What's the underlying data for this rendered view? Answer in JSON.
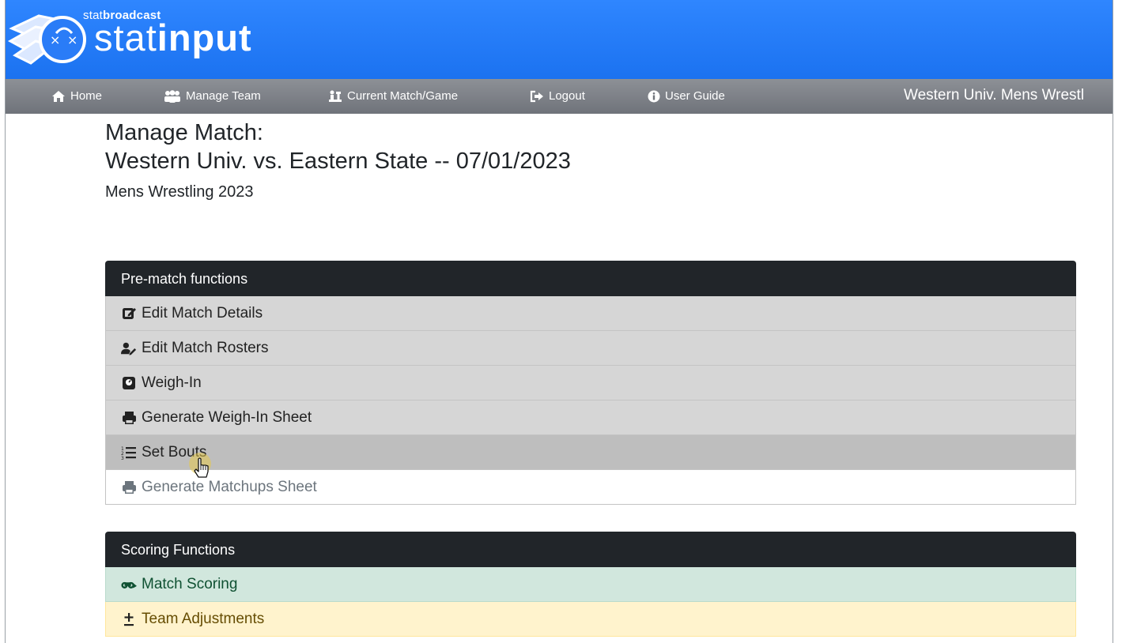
{
  "brand": {
    "small_regular": "stat",
    "small_bold": "broadcast",
    "big_regular": "stat",
    "big_bold": "input"
  },
  "nav": {
    "items": [
      {
        "label": "Home",
        "icon": "home-icon"
      },
      {
        "label": "Manage Team",
        "icon": "users-icon"
      },
      {
        "label": "Current Match/Game",
        "icon": "chess-icon"
      },
      {
        "label": "Logout",
        "icon": "logout-icon"
      },
      {
        "label": "User Guide",
        "icon": "info-icon"
      }
    ],
    "team_label": "Western Univ. Mens Wrestl"
  },
  "page": {
    "title_line1": "Manage Match:",
    "title_line2": "Western Univ. vs. Eastern State -- 07/01/2023",
    "subtitle": "Mens Wrestling 2023"
  },
  "prematch": {
    "header": "Pre-match functions",
    "items": [
      {
        "label": "Edit Match Details",
        "icon": "edit-icon"
      },
      {
        "label": "Edit Match Rosters",
        "icon": "user-edit-icon"
      },
      {
        "label": "Weigh-In",
        "icon": "scale-icon"
      },
      {
        "label": "Generate Weigh-In Sheet",
        "icon": "print-icon"
      },
      {
        "label": "Set Bouts",
        "icon": "list-ordered-icon"
      },
      {
        "label": "Generate Matchups Sheet",
        "icon": "print-icon"
      }
    ]
  },
  "scoring": {
    "header": "Scoring Functions",
    "items": [
      {
        "label": "Match Scoring",
        "icon": "binoculars-icon"
      },
      {
        "label": "Team Adjustments",
        "icon": "plus-minus-icon"
      }
    ]
  },
  "colors": {
    "brand_blue": "#1b72f0",
    "nav_gray": "#6f737a",
    "panel_header": "#212529",
    "success_bg": "#d1e7dd",
    "warning_bg": "#fff3cd"
  }
}
